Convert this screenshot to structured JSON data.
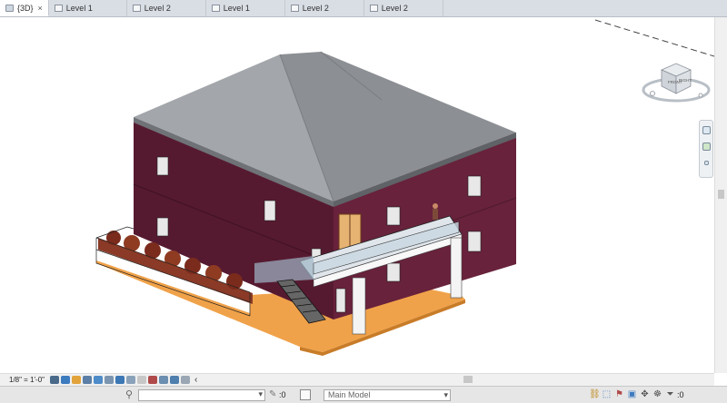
{
  "tabs": [
    {
      "label": "{3D}",
      "active": true,
      "icon": "3d-view-icon"
    },
    {
      "label": "Level 1",
      "active": false,
      "icon": "plan-view-icon"
    },
    {
      "label": "Level 2",
      "active": false,
      "icon": "plan-view-icon"
    },
    {
      "label": "Level 1",
      "active": false,
      "icon": "plan-view-icon"
    },
    {
      "label": "Level 2",
      "active": false,
      "icon": "plan-view-icon"
    },
    {
      "label": "Level 2",
      "active": false,
      "icon": "plan-view-icon"
    }
  ],
  "tab_close_glyph": "×",
  "view_controls": {
    "scale": "1/8\" = 1'-0\"",
    "icons": [
      "detail-level-icon",
      "visual-style-icon",
      "sun-path-icon",
      "shadows-icon",
      "render-icon",
      "crop-view-icon",
      "show-crop-icon",
      "unlock-3d-icon",
      "temporary-hide-icon",
      "reveal-hidden-icon",
      "analytical-model-icon",
      "highlight-displacement-icon",
      "worksharing-display-icon"
    ]
  },
  "viewcube": {
    "top_label": "FRONT",
    "right_label": "RIGHT"
  },
  "status_bar": {
    "selection_count": ":0",
    "editable_count": ":0",
    "filter_count": ":0",
    "model_selector": "Main Model"
  },
  "colors": {
    "wall": "#5b1f33",
    "roof": "#8f9296",
    "deck": "#f2a64a",
    "trim": "#f7f7f7"
  }
}
